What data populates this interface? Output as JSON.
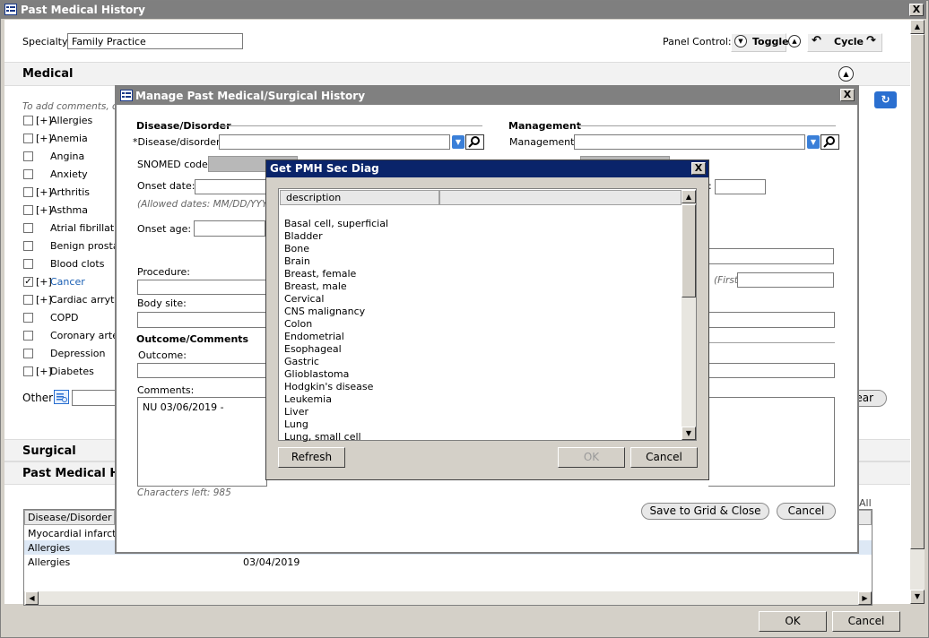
{
  "main_window": {
    "title": "Past Medical History",
    "close": "X",
    "specialty_label": "Specialty:",
    "specialty_value": "Family Practice",
    "panel_control_label": "Panel Control:",
    "toggle_label": "Toggle",
    "cycle_label": "Cycle",
    "medical_title": "Medical",
    "add_comments_hint": "To add comments, clic",
    "conditions": [
      {
        "prefix": "[+]",
        "label": "Allergies",
        "checked": false
      },
      {
        "prefix": "[+]",
        "label": "Anemia",
        "checked": false
      },
      {
        "prefix": "",
        "label": "Angina",
        "checked": false
      },
      {
        "prefix": "",
        "label": "Anxiety",
        "checked": false
      },
      {
        "prefix": "[+]",
        "label": "Arthritis",
        "checked": false
      },
      {
        "prefix": "[+]",
        "label": "Asthma",
        "checked": false
      },
      {
        "prefix": "",
        "label": "Atrial fibrillati",
        "checked": false
      },
      {
        "prefix": "",
        "label": "Benign prosta",
        "checked": false
      },
      {
        "prefix": "",
        "label": "Blood clots",
        "checked": false
      },
      {
        "prefix": "[+]",
        "label": "Cancer",
        "checked": true
      },
      {
        "prefix": "[+]",
        "label": "Cardiac arryth",
        "checked": false
      },
      {
        "prefix": "",
        "label": "COPD",
        "checked": false
      },
      {
        "prefix": "",
        "label": "Coronary arte",
        "checked": false
      },
      {
        "prefix": "",
        "label": "Depression",
        "checked": false
      },
      {
        "prefix": "[+]",
        "label": "Diabetes",
        "checked": false
      }
    ],
    "other_label": "Other",
    "clear_label_fragment": "ear",
    "surgical_title": "Surgical",
    "pmh_title": "Past Medical His",
    "all_fragment": "All",
    "grid_header": "Disease/Disorder",
    "grid_rows": [
      {
        "name": "Myocardial infarcti",
        "date": ""
      },
      {
        "name": "Allergies",
        "date": ""
      },
      {
        "name": "Allergies",
        "date": "03/04/2019"
      }
    ],
    "ok_label": "OK",
    "cancel_label": "Cancel"
  },
  "manage_dialog": {
    "title": "Manage Past Medical/Surgical History",
    "close": "X",
    "disease_section": "Disease/Disorder",
    "disease_label": "*Disease/disorder:",
    "management_section": "Management",
    "management_label": "Management:",
    "snomed_label": "SNOMED code:",
    "onset_date_label": "Onset date:",
    "allowed_dates": "(Allowed dates: MM/DD/YYYY,",
    "onset_age_label": "Onset age:",
    "procedure_label": "Procedure:",
    "first_label": "(First)",
    "body_site_label": "Body site:",
    "outcome_section": "Outcome/Comments",
    "outcome_label": "Outcome:",
    "comments_label": "Comments:",
    "comments_value": "NU 03/06/2019 -",
    "chars_left": "Characters left: 985",
    "save_label": "Save to Grid & Close",
    "cancel_label": "Cancel"
  },
  "sec_diag_dialog": {
    "title": "Get PMH Sec Diag",
    "close": "X",
    "column_header": "description",
    "items": [
      "Basal cell, superficial",
      "Bladder",
      "Bone",
      "Brain",
      "Breast, female",
      "Breast, male",
      "Cervical",
      "CNS malignancy",
      "Colon",
      "Endometrial",
      "Esophageal",
      "Gastric",
      "Glioblastoma",
      "Hodgkin's disease",
      "Leukemia",
      "Liver",
      "Lung",
      "Lung, small cell"
    ],
    "refresh_label": "Refresh",
    "ok_label": "OK",
    "cancel_label": "Cancel"
  },
  "colors": {
    "sec_diag_titlebar": "#0a246a",
    "inactive_titlebar": "#808080",
    "link_blue": "#1a5fb4"
  }
}
